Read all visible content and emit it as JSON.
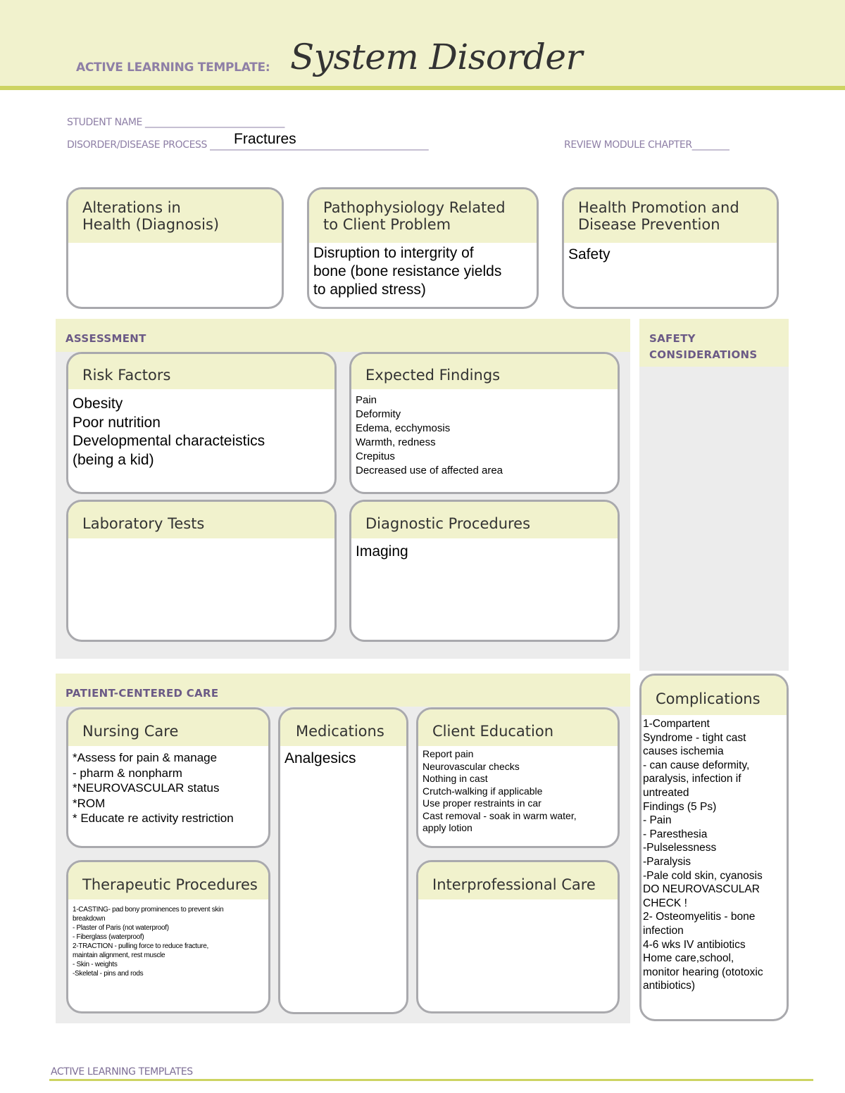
{
  "header": {
    "label": "ACTIVE LEARNING TEMPLATE:",
    "title": "System Disorder"
  },
  "meta": {
    "student_name_label": "STUDENT NAME",
    "student_name_value": "",
    "student_name_line": "______________________________",
    "disorder_label": "DISORDER/DISEASE PROCESS",
    "disorder_value": "Fractures",
    "disorder_line": "_______________________________________________",
    "chapter_label": "REVIEW MODULE CHAPTER",
    "chapter_line": "________"
  },
  "top_boxes": {
    "alterations": {
      "title": "Alterations in\nHealth (Diagnosis)",
      "content": ""
    },
    "pathophysiology": {
      "title": "Pathophysiology Related\nto Client Problem",
      "content": "Disruption to intergrity of\nbone (bone resistance yields\nto applied stress)"
    },
    "health_promotion": {
      "title": "Health Promotion and\nDisease Prevention",
      "content": "Safety"
    }
  },
  "assessment": {
    "section_title": "ASSESSMENT",
    "risk_factors": {
      "title": "Risk Factors",
      "content": "Obesity\nPoor nutrition\nDevelopmental characteistics\n(being a kid)"
    },
    "expected_findings": {
      "title": "Expected Findings",
      "content": "Pain\nDeformity\nEdema, ecchymosis\nWarmth, redness\nCrepitus\nDecreased use of affected area"
    },
    "laboratory_tests": {
      "title": "Laboratory Tests",
      "content": ""
    },
    "diagnostic_procedures": {
      "title": "Diagnostic Procedures",
      "content": "Imaging"
    }
  },
  "safety": {
    "section_title": "SAFETY\nCONSIDERATIONS"
  },
  "patient_care": {
    "section_title": "PATIENT-CENTERED CARE",
    "nursing_care": {
      "title": "Nursing Care",
      "content": "*Assess for pain & manage\n   - pharm & nonpharm\n*NEUROVASCULAR status\n*ROM\n* Educate re activity restriction"
    },
    "medications": {
      "title": "Medications",
      "content": "Analgesics"
    },
    "client_education": {
      "title": "Client Education",
      "content": "Report pain\nNeurovascular checks\nNothing in cast\nCrutch-walking if applicable\nUse proper restraints in car\nCast removal - soak in warm water,\napply lotion"
    },
    "therapeutic_procedures": {
      "title": "Therapeutic Procedures",
      "content": "1-CASTING- pad bony prominences to prevent skin\nbreakdown\n - Plaster of Paris (not waterproof)\n- Fiberglass (waterproof)\n2-TRACTION - pulling force to reduce fracture,\nmaintain alignment, rest muscle\n - Skin - weights\n-Skeletal - pins and rods"
    },
    "interprofessional_care": {
      "title": "Interprofessional Care",
      "content": ""
    }
  },
  "complications": {
    "title": "Complications",
    "content": "1-Compartent\nSyndrome - tight cast\ncauses ischemia\n - can cause deformity,\nparalysis, infection if\nuntreated\nFindings (5 Ps)\n- Pain\n- Paresthesia\n-Pulselessness\n-Paralysis\n-Pale cold skin, cyanosis\nDO NEUROVASCULAR\nCHECK !\n2- Osteomyelitis - bone\ninfection\n 4-6 wks IV antibiotics\nHome care,school,\nmonitor hearing (ototoxic\nantibiotics)"
  },
  "footer": {
    "label": "ACTIVE LEARNING TEMPLATES"
  },
  "colors": {
    "header_band": "#f1f2cd",
    "accent_rule": "#cdd462",
    "label_purple": "#8e7fa6",
    "section_purple": "#6b5a86",
    "panel_gray": "#ececec",
    "box_border": "#a9a9ad"
  }
}
